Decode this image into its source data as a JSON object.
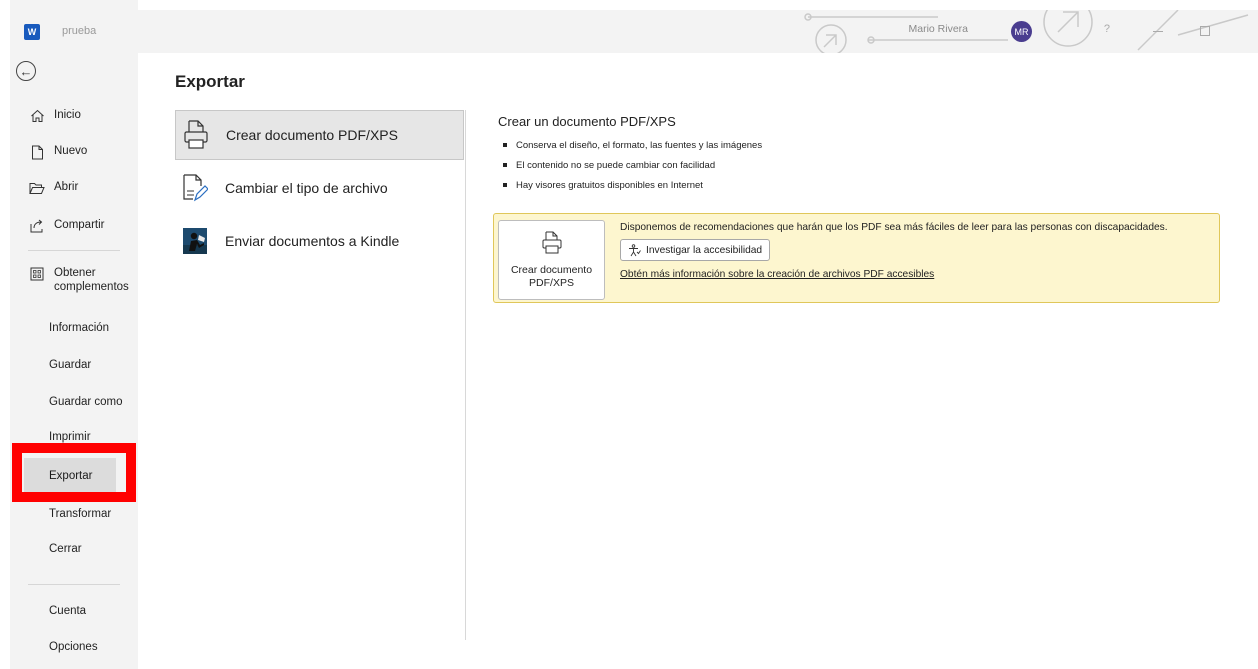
{
  "titlebar": {
    "app_icon": "W",
    "document_name": "prueba",
    "user_name": "Mario Rivera",
    "user_initials": "MR",
    "help": "?"
  },
  "nav": {
    "items": [
      {
        "label": "Inicio",
        "icon": "home-icon"
      },
      {
        "label": "Nuevo",
        "icon": "new-document-icon"
      },
      {
        "label": "Abrir",
        "icon": "folder-open-icon"
      },
      {
        "label": "Compartir",
        "icon": "share-icon"
      },
      {
        "label": "Obtener complementos",
        "icon": "addins-icon"
      },
      {
        "label": "Información"
      },
      {
        "label": "Guardar"
      },
      {
        "label": "Guardar como"
      },
      {
        "label": "Imprimir"
      },
      {
        "label": "Exportar"
      },
      {
        "label": "Transformar"
      },
      {
        "label": "Cerrar"
      },
      {
        "label": "Cuenta"
      },
      {
        "label": "Opciones"
      }
    ],
    "active": "Exportar"
  },
  "main": {
    "title": "Exportar",
    "options": [
      {
        "label": "Crear documento PDF/XPS",
        "icon": "pdf-document-icon",
        "selected": true
      },
      {
        "label": "Cambiar el tipo de archivo",
        "icon": "change-file-type-icon",
        "selected": false
      },
      {
        "label": "Enviar documentos a Kindle",
        "icon": "kindle-icon",
        "selected": false
      }
    ]
  },
  "detail": {
    "title": "Crear un documento PDF/XPS",
    "bullets": [
      "Conserva el diseño, el formato, las fuentes y las imágenes",
      "El contenido no se puede cambiar con facilidad",
      "Hay visores gratuitos disponibles en Internet"
    ],
    "button_label": "Crear documento PDF/XPS",
    "info_text": "Disponemos de recomendaciones que harán que los PDF sea más fáciles de leer para las personas con discapacidades.",
    "accessibility_button": "Investigar la accesibilidad",
    "info_link": "Obtén más información sobre la creación de archivos PDF accesibles"
  },
  "colors": {
    "word_blue": "#185abd",
    "nav_bg": "#f3f3f3",
    "info_bg": "#fdf6cf",
    "highlight": "#ff0000",
    "avatar": "#4a3d8f"
  }
}
